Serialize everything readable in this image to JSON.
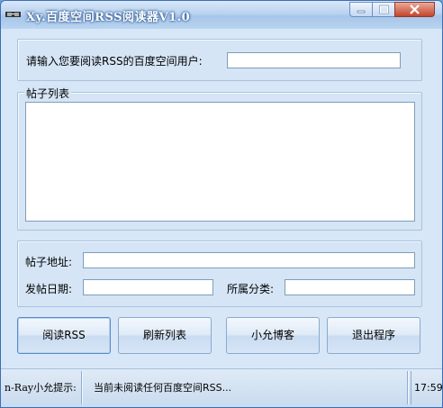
{
  "window": {
    "title": "Xy.百度空间RSS阅读器V1.0"
  },
  "user_section": {
    "label": "请输入您要阅读RSS的百度空间用户:",
    "username_value": ""
  },
  "posts_group": {
    "legend": "帖子列表",
    "items": []
  },
  "details": {
    "post_url_label": "帖子地址:",
    "post_url_value": "",
    "post_date_label": "发帖日期:",
    "post_date_value": "",
    "category_label": "所属分类:",
    "category_value": ""
  },
  "buttons": {
    "read_rss": "阅读RSS",
    "refresh_list": "刷新列表",
    "blog": "小允博客",
    "exit": "退出程序"
  },
  "status_bar": {
    "prefix": "n-Ray小允提示:",
    "message": "当前未阅读任何百度空间RSS...",
    "time": "17:59"
  },
  "colors": {
    "title_bar": "#b9d4f0",
    "client_bg": "#d7e7f7",
    "field_border": "#7f9db9",
    "close_button": "#c4452b"
  }
}
